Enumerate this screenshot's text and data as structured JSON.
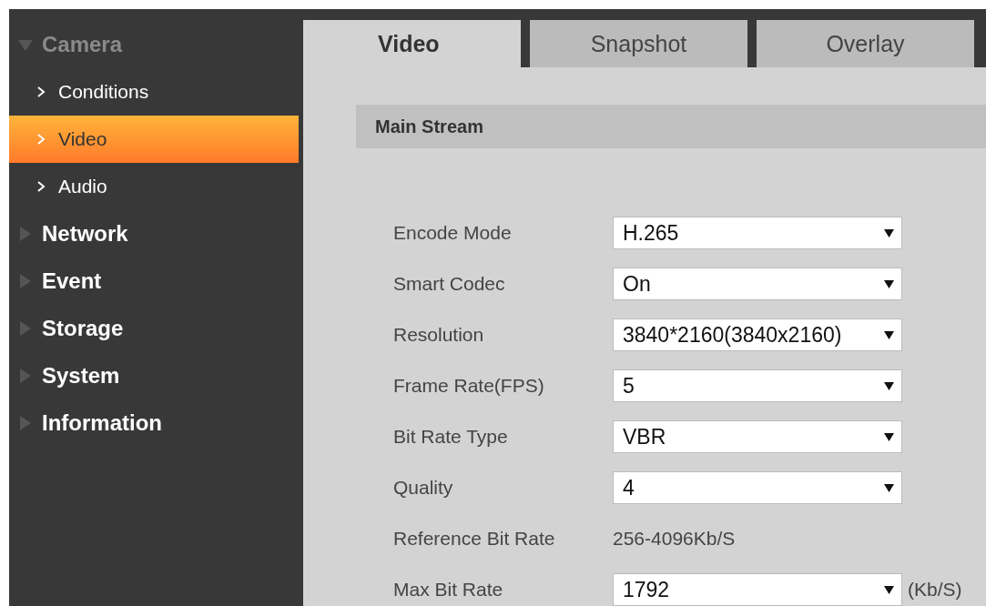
{
  "sidebar": {
    "items": [
      {
        "label": "Camera",
        "expanded": true,
        "children": [
          {
            "label": "Conditions",
            "selected": false
          },
          {
            "label": "Video",
            "selected": true
          },
          {
            "label": "Audio",
            "selected": false
          }
        ]
      },
      {
        "label": "Network",
        "expanded": false
      },
      {
        "label": "Event",
        "expanded": false
      },
      {
        "label": "Storage",
        "expanded": false
      },
      {
        "label": "System",
        "expanded": false
      },
      {
        "label": "Information",
        "expanded": false
      }
    ]
  },
  "tabs": [
    {
      "label": "Video",
      "selected": true
    },
    {
      "label": "Snapshot",
      "selected": false
    },
    {
      "label": "Overlay",
      "selected": false
    }
  ],
  "section": {
    "title": "Main Stream"
  },
  "form": {
    "rows": [
      {
        "kind": "select",
        "label": "Encode Mode",
        "value": "H.265"
      },
      {
        "kind": "select",
        "label": "Smart Codec",
        "value": "On"
      },
      {
        "kind": "select",
        "label": "Resolution",
        "value": "3840*2160(3840x2160)"
      },
      {
        "kind": "select",
        "label": "Frame Rate(FPS)",
        "value": "5"
      },
      {
        "kind": "select",
        "label": "Bit Rate Type",
        "value": "VBR"
      },
      {
        "kind": "select",
        "label": "Quality",
        "value": "4"
      },
      {
        "kind": "text",
        "label": "Reference Bit Rate",
        "value": "256-4096Kb/S"
      },
      {
        "kind": "select",
        "label": "Max Bit Rate",
        "value": "1792",
        "unit": "(Kb/S)"
      }
    ]
  }
}
